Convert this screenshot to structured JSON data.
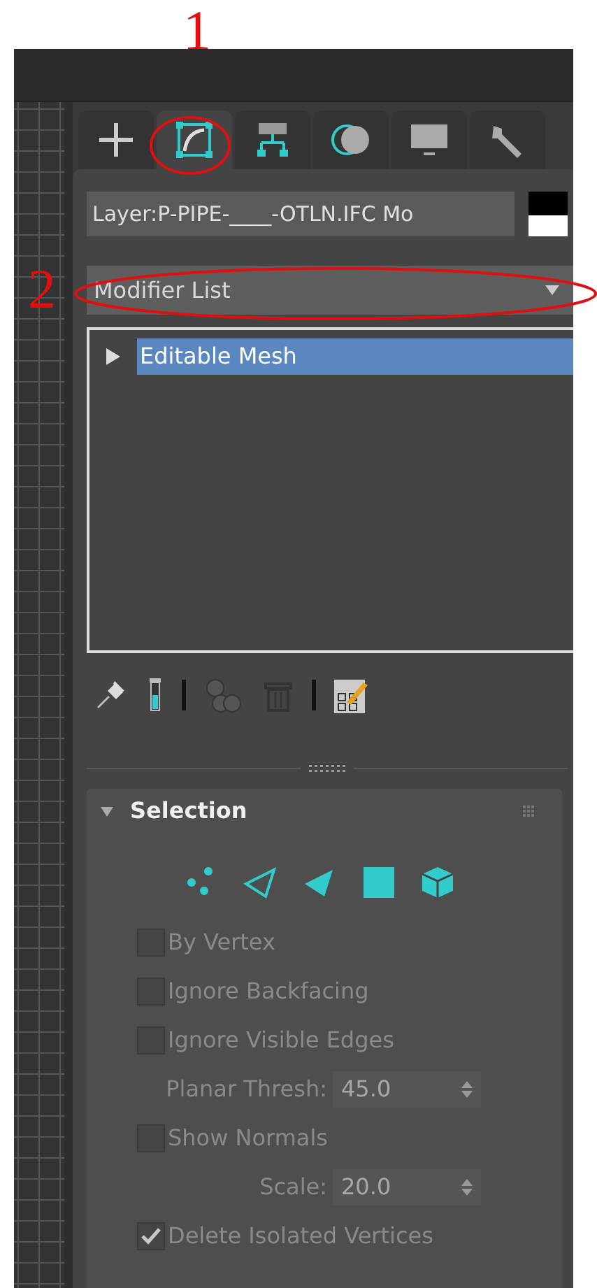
{
  "annotations": [
    {
      "label": "1"
    },
    {
      "label": "2"
    }
  ],
  "tabs": [
    {
      "kind": "create",
      "selected": false
    },
    {
      "kind": "modify",
      "selected": true
    },
    {
      "kind": "hierarchy",
      "selected": false
    },
    {
      "kind": "motion",
      "selected": false
    },
    {
      "kind": "display",
      "selected": false
    },
    {
      "kind": "utilities",
      "selected": false
    }
  ],
  "object_name": {
    "value": "Layer:P-PIPE-____-OTLN.IFC Mo"
  },
  "modifier_list": {
    "label": "Modifier List"
  },
  "modifier_stack": [
    {
      "label": "Editable Mesh",
      "selected": true,
      "expanded": false
    }
  ],
  "stack_toolbar": [
    {
      "kind": "pin"
    },
    {
      "kind": "test-tube"
    },
    {
      "kind": "separator"
    },
    {
      "kind": "make-unique"
    },
    {
      "kind": "trash"
    },
    {
      "kind": "separator"
    },
    {
      "kind": "configure"
    }
  ],
  "selection_rollout": {
    "title": "Selection",
    "expanded": true,
    "levels": [
      {
        "kind": "vertex"
      },
      {
        "kind": "edge"
      },
      {
        "kind": "face"
      },
      {
        "kind": "polygon"
      },
      {
        "kind": "element"
      }
    ],
    "options": [
      {
        "kind": "checkbox",
        "label": "By Vertex",
        "checked": false,
        "disabled": true
      },
      {
        "kind": "checkbox",
        "label": "Ignore Backfacing",
        "checked": false,
        "disabled": true
      },
      {
        "kind": "checkbox",
        "label": "Ignore Visible Edges",
        "checked": false,
        "disabled": true
      },
      {
        "kind": "spinner",
        "label": "Planar Thresh:",
        "value": "45.0",
        "disabled": true
      },
      {
        "kind": "checkbox",
        "label": "Show Normals",
        "checked": false,
        "disabled": true
      },
      {
        "kind": "spinner",
        "label": "Scale:",
        "value": "20.0",
        "disabled": true
      },
      {
        "kind": "checkbox",
        "label": "Delete Isolated Vertices",
        "checked": true,
        "disabled": true
      }
    ]
  }
}
